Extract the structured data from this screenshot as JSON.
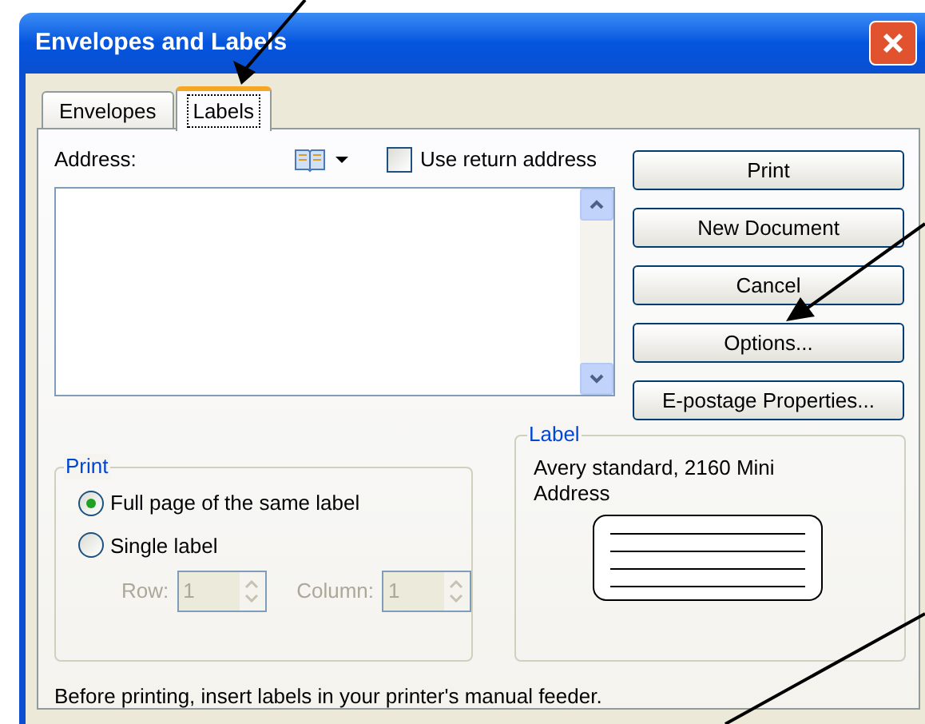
{
  "window": {
    "title": "Envelopes and Labels"
  },
  "tabs": [
    {
      "label": "Envelopes",
      "selected": false
    },
    {
      "label": "Labels",
      "selected": true
    }
  ],
  "address": {
    "label": "Address:",
    "use_return_address": {
      "label": "Use return address",
      "checked": false
    }
  },
  "buttons": [
    "Print",
    "New Document",
    "Cancel",
    "Options...",
    "E-postage Properties..."
  ],
  "print_group": {
    "title": "Print",
    "options": [
      {
        "label": "Full page of the same label",
        "selected": true
      },
      {
        "label": "Single label",
        "selected": false
      }
    ],
    "row": {
      "label": "Row:",
      "value": "1",
      "disabled": true
    },
    "column": {
      "label": "Column:",
      "value": "1",
      "disabled": true
    }
  },
  "label_group": {
    "title": "Label",
    "description": "Avery standard, 2160 Mini Address"
  },
  "note": "Before printing, insert labels in your printer's manual feeder."
}
